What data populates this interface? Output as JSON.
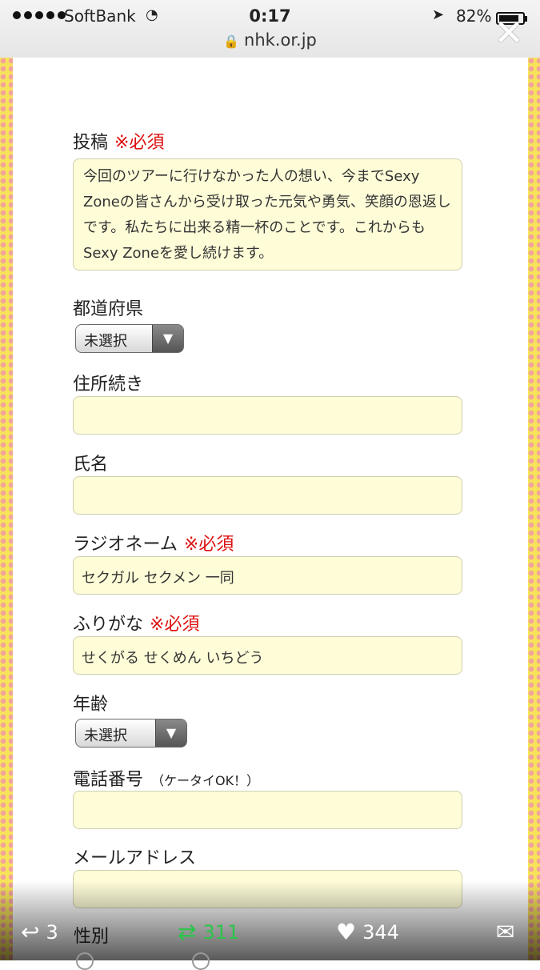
{
  "status": {
    "carrier": "SoftBank",
    "time": "0:17",
    "battery": "82%",
    "url": "nhk.or.jp"
  },
  "form": {
    "post": {
      "label": "投稿",
      "required": "※必須",
      "value": "今回のツアーに行けなかった人の想い、今までSexy Zoneの皆さんから受け取った元気や勇気、笑顔の恩返しです。私たちに出来る精一杯のことです。これからもSexy Zoneを愛し続けます。"
    },
    "prefecture": {
      "label": "都道府県",
      "value": "未選択"
    },
    "address": {
      "label": "住所続き",
      "value": ""
    },
    "name": {
      "label": "氏名",
      "value": ""
    },
    "radio_name": {
      "label": "ラジオネーム",
      "required": "※必須",
      "value": "セクガル セクメン 一同"
    },
    "furigana": {
      "label": "ふりがな",
      "required": "※必須",
      "value": "せくがる せくめん いちどう"
    },
    "age": {
      "label": "年齢",
      "value": "未選択"
    },
    "phone": {
      "label": "電話番号",
      "note": "（ケータイOK！）",
      "value": ""
    },
    "email": {
      "label": "メールアドレス",
      "value": ""
    },
    "gender": {
      "label": "性別"
    }
  },
  "actions": {
    "reply_count": "3",
    "retweet_count": "311",
    "like_count": "344"
  },
  "colors": {
    "field_bg": "#fffdd8",
    "required": "#dd1111",
    "retweet": "#2cc54a"
  },
  "icons": [
    "signal-dots-icon",
    "wifi-icon",
    "location-arrow-icon",
    "battery-icon",
    "lock-icon",
    "close-icon",
    "reply-icon",
    "retweet-icon",
    "heart-icon",
    "mail-icon",
    "select-arrow-icon"
  ]
}
